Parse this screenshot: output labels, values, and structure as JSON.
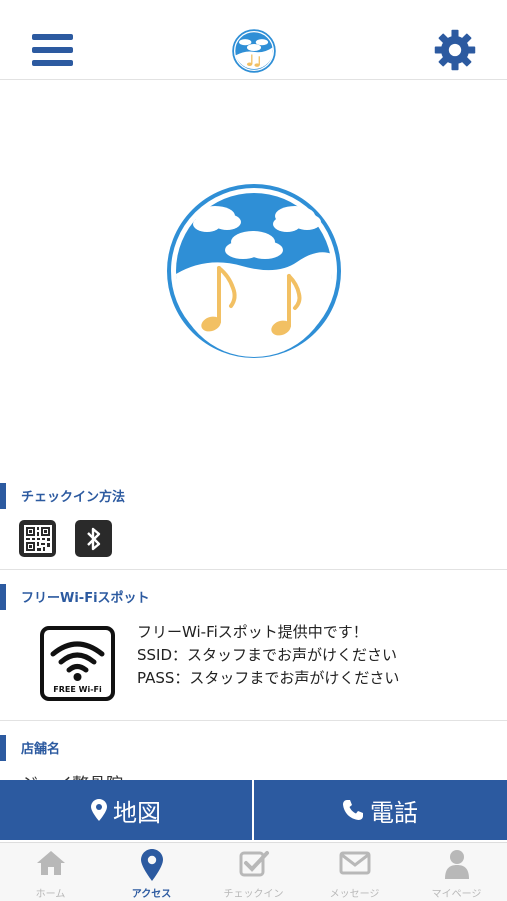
{
  "header": {
    "menu_icon": "hamburger-menu-icon",
    "logo": "app-logo",
    "settings_icon": "gear-icon"
  },
  "checkin": {
    "title": "チェックイン方法",
    "methods": [
      "qr-code-icon",
      "bluetooth-icon"
    ]
  },
  "wifi": {
    "title": "フリーWi-Fiスポット",
    "badge_label": "FREE Wi-Fi",
    "lines": [
      "フリーWi-Fiスポット提供中です！",
      "SSID：スタッフまでお声がけください",
      "PASS：スタッフまでお声がけください"
    ]
  },
  "store": {
    "title": "店舗名",
    "name_partial": "ジーイ整骨院"
  },
  "actions": {
    "map_label": "地図",
    "phone_label": "電話"
  },
  "tabs": [
    {
      "label": "ホーム",
      "icon": "home-icon"
    },
    {
      "label": "アクセス",
      "icon": "map-pin-icon"
    },
    {
      "label": "チェックイン",
      "icon": "checkin-icon"
    },
    {
      "label": "メッセージ",
      "icon": "mail-icon"
    },
    {
      "label": "マイページ",
      "icon": "user-icon"
    }
  ],
  "colors": {
    "accent": "#2c5aa0",
    "logo_blue": "#2f8fd6",
    "note_gold": "#f2c063",
    "tab_inactive": "#b8b8b8"
  }
}
